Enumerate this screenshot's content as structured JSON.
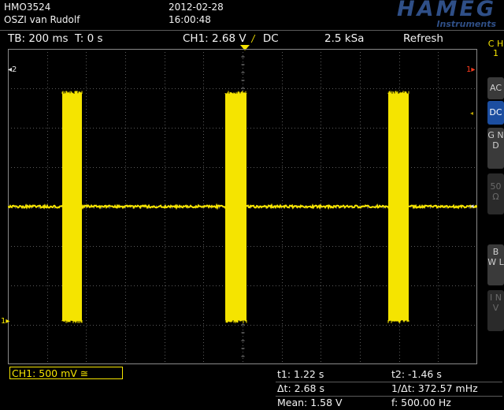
{
  "header": {
    "model": "HMO3524",
    "owner": "OSZI van Rudolf",
    "date": "2012-02-28",
    "time": "16:00:48",
    "brand": "HAMEG",
    "brand_sub": "Instruments"
  },
  "status": {
    "timebase": "TB: 200 ms",
    "trigger_time": "T: 0 s",
    "trigger_info": "CH1: 2.68 V",
    "trigger_edge": "⎍",
    "trigger_coupling": "DC",
    "sample_rate": "2.5 kSa",
    "mode": "Refresh"
  },
  "markers": {
    "cursor2": "2",
    "cursor1": "1",
    "trigger_level": "1",
    "channel_ground": "1"
  },
  "side_buttons": {
    "channel": "C H 1",
    "ac": "AC",
    "dc": "DC",
    "gnd": "G N D",
    "ohm": "50 Ω",
    "bwl": "B W L",
    "inv": "I N V"
  },
  "channel_box": "CH1: 500 mV ≅",
  "measurements": {
    "t1": "t1: 1.22 s",
    "t2": "t2: -1.46 s",
    "dt": "Δt: 2.68 s",
    "inv_dt": "1/Δt: 372.57 mHz",
    "mean": "Mean: 1.58 V",
    "freq": "f: 500.00 Hz"
  },
  "colors": {
    "trace": "#f5e400",
    "accent": "#1c4ea0",
    "brand": "#2f4f87"
  }
}
